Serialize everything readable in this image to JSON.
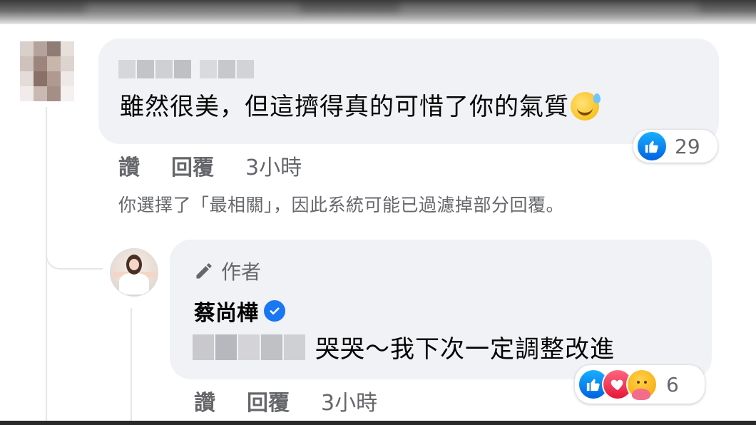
{
  "colors": {
    "bubble_bg": "#f0f2f5",
    "secondary_text": "#65676b",
    "primary_text": "#050505",
    "like_blue": "#1877f2",
    "love_red": "#e61739",
    "care_yellow": "#f5a300"
  },
  "comment": {
    "author_name": "",
    "author_name_blurred": true,
    "text": "雖然很美，但這擠得真的可惜了你的氣質",
    "trailing_emoji": "grinning-sweat-emoji",
    "reactions": {
      "types": [
        "like"
      ],
      "count": "29"
    },
    "actions": {
      "like_label": "讚",
      "reply_label": "回覆",
      "time": "3小時"
    }
  },
  "filter_notice": "你選擇了「最相關」，因此系統可能已過濾掉部分回覆。",
  "reply": {
    "author_badge": "作者",
    "author_name": "蔡尚樺",
    "verified": true,
    "mention_blurred": true,
    "text": "哭哭～我下次一定調整改進",
    "reactions": {
      "types": [
        "like",
        "love",
        "care"
      ],
      "count": "6"
    },
    "actions": {
      "like_label": "讚",
      "reply_label": "回覆",
      "time": "3小時"
    }
  }
}
